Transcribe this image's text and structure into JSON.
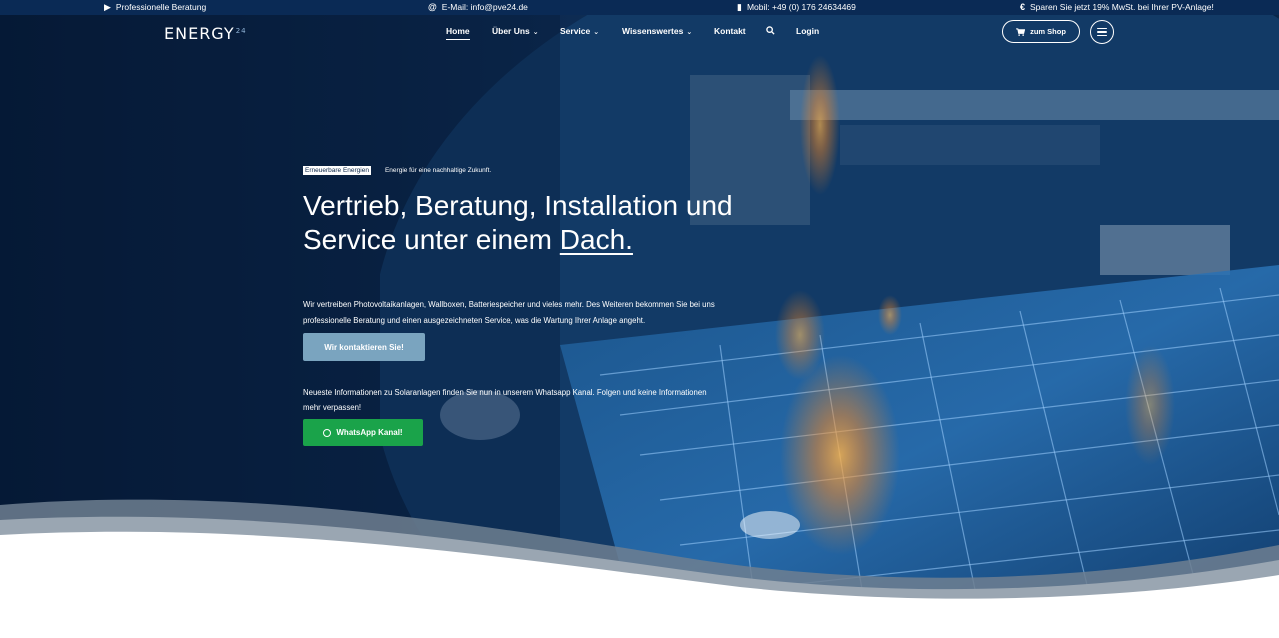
{
  "topbar": {
    "items": [
      {
        "icon": "handshake-icon",
        "label": "Professionelle Beratung"
      },
      {
        "icon": "at-icon",
        "label": "E-Mail: info@pve24.de"
      },
      {
        "icon": "phone-icon",
        "label": "Mobil: +49 (0) 176 24634469"
      },
      {
        "icon": "euro-icon",
        "label": "Sparen Sie jetzt 19% MwSt. bei Ihrer PV-Anlage!"
      }
    ]
  },
  "header": {
    "logo_text": "ENERGY",
    "logo_sup": "24",
    "nav": [
      {
        "label": "Home",
        "active": true
      },
      {
        "label": "Über Uns",
        "dropdown": true
      },
      {
        "label": "Service",
        "dropdown": true
      },
      {
        "label": "Wissenswertes",
        "dropdown": true
      },
      {
        "label": "Kontakt"
      },
      {
        "label": "Login"
      }
    ],
    "search_icon": "search-icon",
    "shop_label": "zum Shop",
    "menu_icon": "hamburger-icon"
  },
  "hero": {
    "tag": "Erneuerbare Energien",
    "tagline": "Energie für eine nachhaltige Zukunft.",
    "headline_part1": "Vertrieb, Beratung, Installation und Service unter einem ",
    "headline_underlined": "Dach.",
    "description": "Wir vertreiben Photovoltaikanlagen, Wallboxen, Batteriespeicher und vieles mehr. Des Weiteren bekommen Sie bei uns professionelle Beratung und einen ausgezeichneten Service, was die Wartung Ihrer Anlage angeht.",
    "contact_button": "Wir kontaktieren Sie!",
    "whatsapp_text": "Neueste Informationen zu Solaranlagen finden Sie nun in unserem Whatsapp Kanal. Folgen und keine Informationen mehr verpassen!",
    "whatsapp_button": "WhatsApp Kanal!"
  },
  "colors": {
    "topbar_bg": "#0a2a55",
    "hero_dark": "#061a36",
    "contact_button": "#7aa4bf",
    "whatsapp_button": "#1aa34a",
    "glow": "#ff9a2e"
  }
}
